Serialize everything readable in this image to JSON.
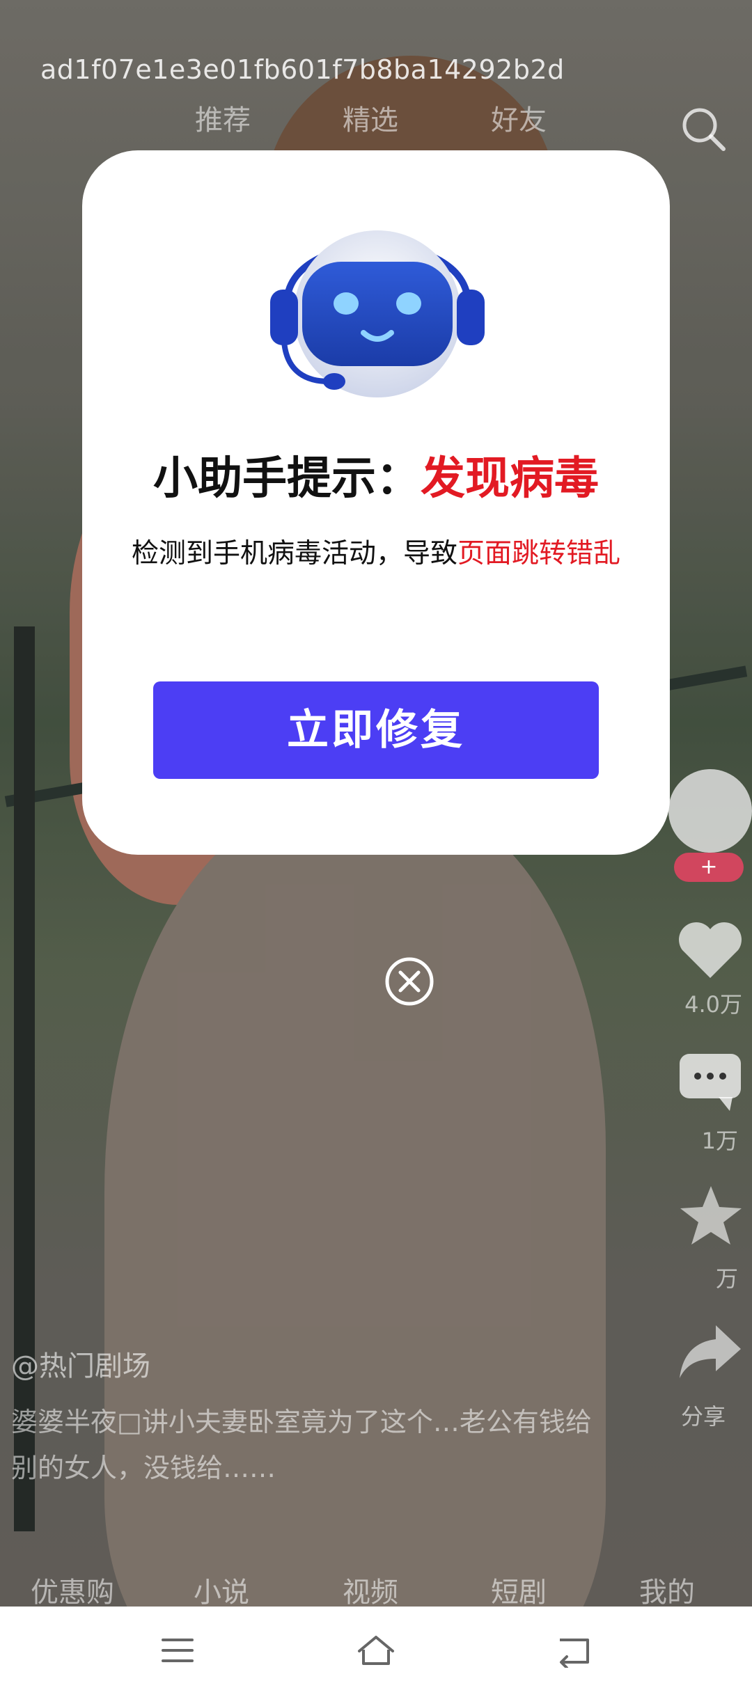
{
  "top": {
    "ad_id": "ad1f07e1e3e01fb601f7b8ba14292b2d",
    "tabs": [
      "推荐",
      "精选",
      "好友"
    ]
  },
  "side": {
    "follow_label": "+",
    "like_count": "4.0万",
    "comment_count": "1万",
    "fav_count": "万",
    "share_label": "分享"
  },
  "post": {
    "author": "@热门剧场",
    "description": "婆婆半夜□讲小夫妻卧室竟为了这个…老公有钱给别的女人，没钱给……"
  },
  "bottom_nav": [
    "优惠购",
    "小说",
    "视频",
    "短剧",
    "我的"
  ],
  "modal": {
    "title_prefix": "小助手提示：",
    "title_alert": "发现病毒",
    "message_prefix": "检测到手机病毒活动，导致",
    "message_alert": "页面跳转错乱",
    "button_label": "立即修复"
  },
  "colors": {
    "alert_red": "#e21a23",
    "button_purple": "#4c3ef4"
  },
  "icons": {
    "search": "search-icon",
    "close": "close-circle-icon",
    "robot": "robot-headset-icon",
    "menu": "menu-icon",
    "home": "home-icon",
    "back": "back-icon"
  }
}
